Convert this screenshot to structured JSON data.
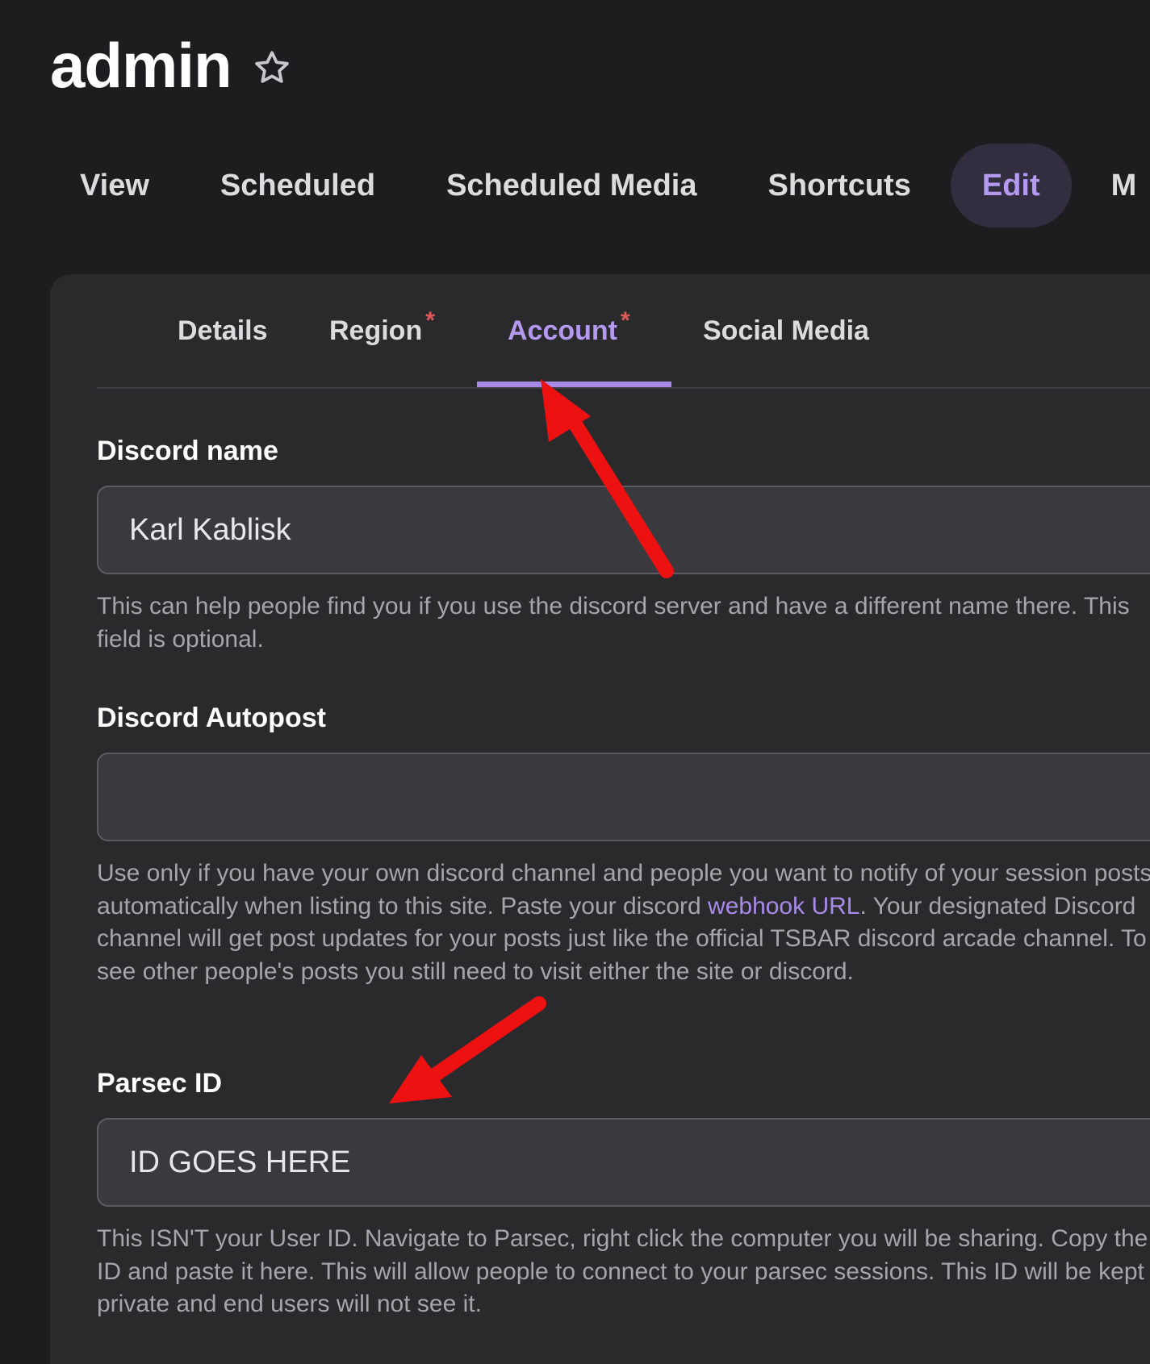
{
  "header": {
    "title": "admin",
    "star_icon": "star-outline-icon"
  },
  "top_nav": {
    "items": [
      "View",
      "Scheduled",
      "Scheduled Media",
      "Shortcuts",
      "Edit",
      "M"
    ],
    "active": "Edit"
  },
  "sub_tabs": {
    "items": [
      {
        "label": "Details",
        "required": false
      },
      {
        "label": "Region",
        "required": true
      },
      {
        "label": "Account",
        "required": true
      },
      {
        "label": "Social Media",
        "required": false
      }
    ],
    "active": "Account",
    "required_marker": "*"
  },
  "form": {
    "discord_name": {
      "label": "Discord name",
      "value": "Karl Kablisk",
      "help": "This can help people find you if you use the discord server and have a different name there. This field is optional."
    },
    "discord_autopost": {
      "label": "Discord Autopost",
      "value": "",
      "help_before_link": "Use only if you have your own discord channel and people you want to notify of your session posts automatically when listing to this site. Paste your discord ",
      "help_link": "webhook URL",
      "help_after_link": ". Your designated Discord channel will get post updates for your posts just like the official TSBAR discord arcade channel. To see other people's posts you still need to visit either the site or discord."
    },
    "parsec_id": {
      "label": "Parsec ID",
      "value": "ID GOES HERE",
      "help": "This ISN'T your User ID. Navigate to Parsec, right click the computer you will be sharing. Copy the ID and paste it here. This will allow people to connect to your parsec sessions. This ID will be kept private and end users will not see it."
    }
  },
  "colors": {
    "background": "#1d1d1f",
    "card": "#2a2a2d",
    "accent": "#a88be8",
    "required": "#e05a5a",
    "annotation_arrow": "#ee1111"
  }
}
